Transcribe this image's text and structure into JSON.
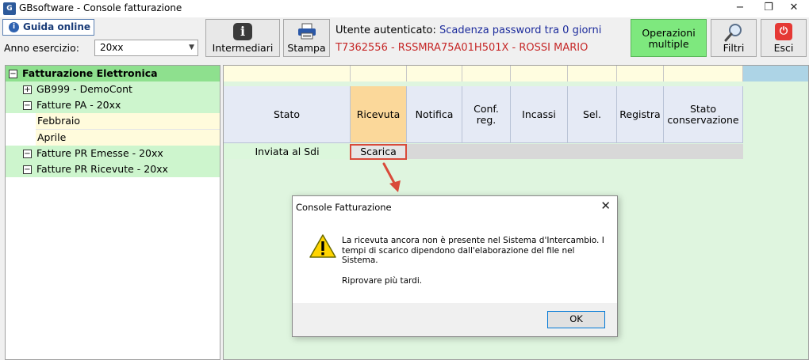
{
  "window": {
    "logo_text": "G",
    "title": "GBsoftware - Console fatturazione",
    "minimize": "−",
    "restore": "❐",
    "close": "✕"
  },
  "toolbar": {
    "guida_label": "Guida online",
    "guida_icon": "i",
    "anno_label": "Anno esercizio:",
    "anno_value": "20xx",
    "intermediari_label": "Intermediari",
    "stampa_label": "Stampa",
    "auth_label": "Utente autenticato:",
    "auth_value": "Scadenza password tra 0 giorni",
    "auth_user": "T7362556 - RSSMRA75A01H501X - ROSSI MARIO",
    "operazioni_line1": "Operazioni",
    "operazioni_line2": "multiple",
    "filtri_label": "Filtri",
    "esci_label": "Esci",
    "colors": {
      "auth_value": "#1c2b9c",
      "auth_user": "#c62828",
      "operazioni_bg": "#7ee87e",
      "esci_icon": "#e53935"
    }
  },
  "tree": {
    "root": {
      "label": "Fatturazione Elettronica",
      "toggle": "−"
    },
    "items": [
      {
        "label": "GB999 - DemoCont",
        "toggle": "+"
      },
      {
        "label": "Fatture PA - 20xx",
        "toggle": "−"
      },
      {
        "label": "Febbraio"
      },
      {
        "label": "Aprile"
      },
      {
        "label": "Fatture PR Emesse - 20xx",
        "toggle": "−"
      },
      {
        "label": "Fatture PR Ricevute - 20xx",
        "toggle": "−"
      }
    ]
  },
  "grid": {
    "columns": [
      {
        "label": "Stato"
      },
      {
        "label": "Ricevuta"
      },
      {
        "label": "Notifica"
      },
      {
        "label1": "Conf.",
        "label2": "reg."
      },
      {
        "label": "Incassi"
      },
      {
        "label": "Sel."
      },
      {
        "label": "Registra"
      },
      {
        "label1": "Stato",
        "label2": "conservazione"
      }
    ],
    "row": {
      "stato": "Inviata al Sdi",
      "ricevuta_button": "Scarica"
    }
  },
  "dialog": {
    "title": "Console Fatturazione",
    "close": "✕",
    "message_line1": "La ricevuta ancora non è presente nel Sistema d'Intercambio. I",
    "message_line2": "tempi di scarico dipendono dall'elaborazione del file nel",
    "message_line3": "Sistema.",
    "message_retry": "Riprovare più tardi.",
    "ok_label": "OK"
  }
}
